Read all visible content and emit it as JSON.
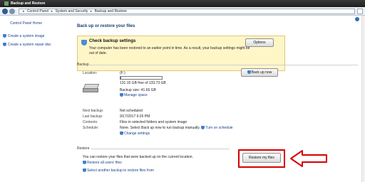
{
  "window": {
    "title": "Backup and Restore"
  },
  "addressbar": {
    "crumbs": [
      "Control Panel",
      "System and Security",
      "Backup and Restore"
    ],
    "separator": "▸"
  },
  "left_pane": {
    "home_link": "Control Panel Home",
    "items": [
      {
        "label": "Create a system image",
        "icon": "shield-icon"
      },
      {
        "label": "Create a system repair disc",
        "icon": "shield-icon"
      }
    ]
  },
  "main": {
    "page_title": "Back up or restore your files",
    "notice": {
      "heading": "Check backup settings",
      "text": "Your computer has been restored to an earlier point in time. As a result, your backup settings might be out of date.",
      "button": "Options"
    },
    "backup": {
      "section_label": "Backup",
      "location_label": "Location:",
      "location_value": "(F:)",
      "free_text": "131.15 GB free of 133.73 GB",
      "used_fraction": 0.019,
      "backup_size": "Backup size: 41.66 GB",
      "manage_space": "Manage space",
      "backup_now_button": "Back up now",
      "next_backup_label": "Next backup:",
      "next_backup_value": "Not scheduled",
      "last_backup_label": "Last backup:",
      "last_backup_value": "9/17/2017 6:26 PM",
      "contents_label": "Contents:",
      "contents_value": "Files in selected folders and system image",
      "schedule_label": "Schedule:",
      "schedule_value": "None. Select Back up now to run backup manually.",
      "turn_on_schedule": "Turn on schedule",
      "change_settings": "Change settings"
    },
    "restore": {
      "section_label": "Restore",
      "text": "You can restore your files that were backed up on the current location.",
      "restore_button": "Restore my files",
      "restore_all_users": "Restore all users' files",
      "select_another": "Select another backup to restore files from"
    }
  },
  "colors": {
    "link": "#1a3f8a",
    "notice_bg": "#fff6c8",
    "highlight": "#d40000",
    "progress": "#2b8ad8"
  }
}
